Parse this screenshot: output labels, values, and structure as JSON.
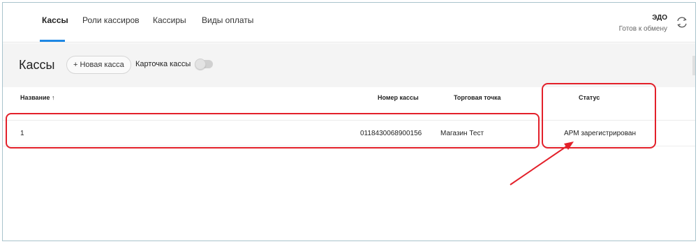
{
  "nav": {
    "tabs": [
      {
        "label": "Кассы",
        "active": true
      },
      {
        "label": "Роли кассиров",
        "active": false
      },
      {
        "label": "Кассиры",
        "active": false
      },
      {
        "label": "Виды оплаты",
        "active": false
      }
    ],
    "edo_title": "ЭДО",
    "edo_status": "Готов к обмену",
    "sync_icon": "sync-icon"
  },
  "toolbar": {
    "title": "Кассы",
    "new_button": "+ Новая касса",
    "card_toggle_label": "Карточка кассы",
    "card_toggle_on": false
  },
  "table": {
    "columns": {
      "name": "Название ↑",
      "number": "Номер кассы",
      "shop": "Торговая точка",
      "status": "Статус"
    },
    "rows": [
      {
        "name": "1",
        "number": "0118430068900156",
        "shop": "Магазин Тест",
        "status": "АРМ зарегистрирован"
      }
    ]
  },
  "colors": {
    "accent": "#1e88e5",
    "annotation": "#e3202a"
  }
}
